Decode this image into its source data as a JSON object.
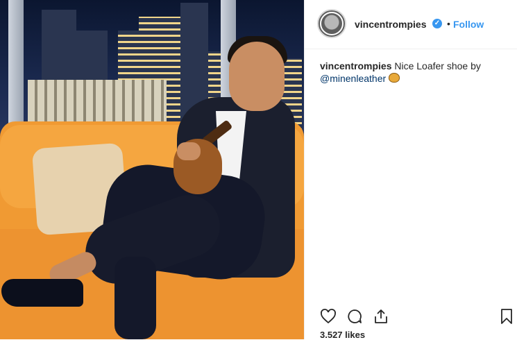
{
  "post": {
    "username": "vincentrompies",
    "follow_label": "Follow",
    "separator": "•",
    "caption": {
      "username": "vincentrompies",
      "text": "Nice Loafer shoe by",
      "mention": "@minenleather"
    },
    "likes": "3.527 likes"
  },
  "icons": {
    "verified": "verified-badge-icon",
    "like": "heart-icon",
    "comment": "comment-icon",
    "share": "share-icon",
    "save": "bookmark-icon",
    "emoji": "shoe-emoji-icon"
  },
  "colors": {
    "accent": "#3897f0",
    "mention": "#003569",
    "text": "#262626"
  }
}
